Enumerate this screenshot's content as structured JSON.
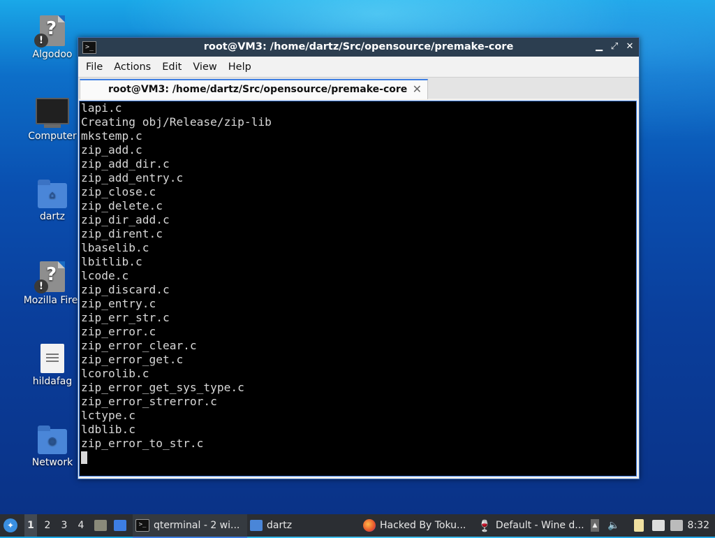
{
  "desktop": {
    "icons": [
      {
        "label": "Algodoo",
        "icon": "unknown-file-icon"
      },
      {
        "label": "Computer",
        "icon": "computer-icon"
      },
      {
        "label": "dartz",
        "icon": "home-folder-icon"
      },
      {
        "label": "Mozilla Firef",
        "icon": "unknown-file-icon"
      },
      {
        "label": "hildafag",
        "icon": "text-file-icon"
      },
      {
        "label": "Network",
        "icon": "network-folder-icon"
      }
    ]
  },
  "window": {
    "title": "root@VM3: /home/dartz/Src/opensource/premake-core",
    "controls": {
      "minimize": "▁",
      "maximize": "⤢",
      "close": "✕"
    },
    "menu": [
      "File",
      "Actions",
      "Edit",
      "View",
      "Help"
    ],
    "tab": {
      "label": "root@VM3: /home/dartz/Src/opensource/premake-core",
      "close": "✕"
    },
    "terminal_lines": [
      "lapi.c",
      "Creating obj/Release/zip-lib",
      "mkstemp.c",
      "zip_add.c",
      "zip_add_dir.c",
      "zip_add_entry.c",
      "zip_close.c",
      "zip_delete.c",
      "zip_dir_add.c",
      "zip_dirent.c",
      "lbaselib.c",
      "lbitlib.c",
      "lcode.c",
      "zip_discard.c",
      "zip_entry.c",
      "zip_err_str.c",
      "zip_error.c",
      "zip_error_clear.c",
      "zip_error_get.c",
      "lcorolib.c",
      "zip_error_get_sys_type.c",
      "zip_error_strerror.c",
      "lctype.c",
      "ldblib.c",
      "zip_error_to_str.c"
    ]
  },
  "taskbar": {
    "workspaces": [
      "1",
      "2",
      "3",
      "4"
    ],
    "active_workspace": "1",
    "windows": [
      {
        "label": "qterminal - 2 wi...",
        "icon": "terminal-icon",
        "active": true
      },
      {
        "label": "dartz",
        "icon": "folder-icon",
        "active": false
      },
      {
        "label": "Hacked By Toku...",
        "icon": "firefox-icon",
        "active": false
      },
      {
        "label": "Default - Wine d...",
        "icon": "wine-icon",
        "active": false
      }
    ],
    "clock": "8:32",
    "colors": {
      "accent": "#3d7ee3",
      "panel": "#2b2e33"
    }
  }
}
